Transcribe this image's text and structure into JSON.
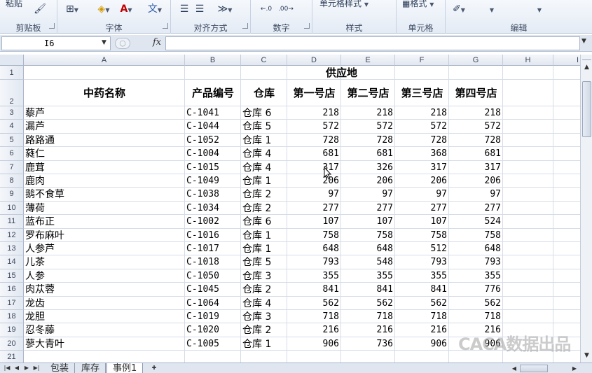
{
  "ribbon": {
    "groups": [
      {
        "label": "剪贴板"
      },
      {
        "label": "字体"
      },
      {
        "label": "对齐方式"
      },
      {
        "label": "数字"
      },
      {
        "label": "样式"
      },
      {
        "label": "单元格"
      },
      {
        "label": "编辑"
      }
    ],
    "format_label": "格式",
    "cell_style_label": "单元格样式",
    "paste_label": "粘贴"
  },
  "formula_bar": {
    "name_box": "I6",
    "fx": "fx",
    "formula": ""
  },
  "columns": [
    "A",
    "B",
    "C",
    "D",
    "E",
    "F",
    "G",
    "H",
    "I"
  ],
  "rows": [
    "1",
    "2",
    "3",
    "4",
    "5",
    "6",
    "7",
    "8",
    "9",
    "10",
    "11",
    "12",
    "13",
    "14",
    "15",
    "16",
    "17",
    "18",
    "19",
    "20",
    "21"
  ],
  "sheet": {
    "group_header": "供应地",
    "headers": [
      "中药名称",
      "产品编号",
      "仓库",
      "第一号店",
      "第二号店",
      "第三号店",
      "第四号店"
    ],
    "data": [
      [
        "藜芦",
        "C-1041",
        "仓库 6",
        "218",
        "218",
        "218",
        "218"
      ],
      [
        "漏芦",
        "C-1044",
        "仓库 5",
        "572",
        "572",
        "572",
        "572"
      ],
      [
        "路路通",
        "C-1052",
        "仓库 1",
        "728",
        "728",
        "728",
        "728"
      ],
      [
        "蕤仁",
        "C-1004",
        "仓库 4",
        "681",
        "681",
        "368",
        "681"
      ],
      [
        "鹿茸",
        "C-1015",
        "仓库 4",
        "317",
        "326",
        "317",
        "317"
      ],
      [
        "鹿肉",
        "C-1049",
        "仓库 1",
        "206",
        "206",
        "206",
        "206"
      ],
      [
        "鹅不食草",
        "C-1038",
        "仓库 2",
        "97",
        "97",
        "97",
        "97"
      ],
      [
        "薄荷",
        "C-1034",
        "仓库 2",
        "277",
        "277",
        "277",
        "277"
      ],
      [
        "蓝布正",
        "C-1002",
        "仓库 6",
        "107",
        "107",
        "107",
        "524"
      ],
      [
        "罗布麻叶",
        "C-1016",
        "仓库 1",
        "758",
        "758",
        "758",
        "758"
      ],
      [
        "人参芦",
        "C-1017",
        "仓库 1",
        "648",
        "648",
        "512",
        "648"
      ],
      [
        "儿茶",
        "C-1018",
        "仓库 5",
        "793",
        "548",
        "793",
        "793"
      ],
      [
        "人参",
        "C-1050",
        "仓库 3",
        "355",
        "355",
        "355",
        "355"
      ],
      [
        "肉苁蓉",
        "C-1045",
        "仓库 2",
        "841",
        "841",
        "841",
        "776"
      ],
      [
        "龙齿",
        "C-1064",
        "仓库 4",
        "562",
        "562",
        "562",
        "562"
      ],
      [
        "龙胆",
        "C-1019",
        "仓库 3",
        "718",
        "718",
        "718",
        "718"
      ],
      [
        "忍冬藤",
        "C-1020",
        "仓库 2",
        "216",
        "216",
        "216",
        "216"
      ],
      [
        "蓼大青叶",
        "C-1005",
        "仓库 1",
        "906",
        "736",
        "906",
        "906"
      ]
    ]
  },
  "tabs": [
    {
      "label": "包装"
    },
    {
      "label": "库存"
    },
    {
      "label": "事例1",
      "active": true
    }
  ],
  "watermark": "CACA数据出品"
}
